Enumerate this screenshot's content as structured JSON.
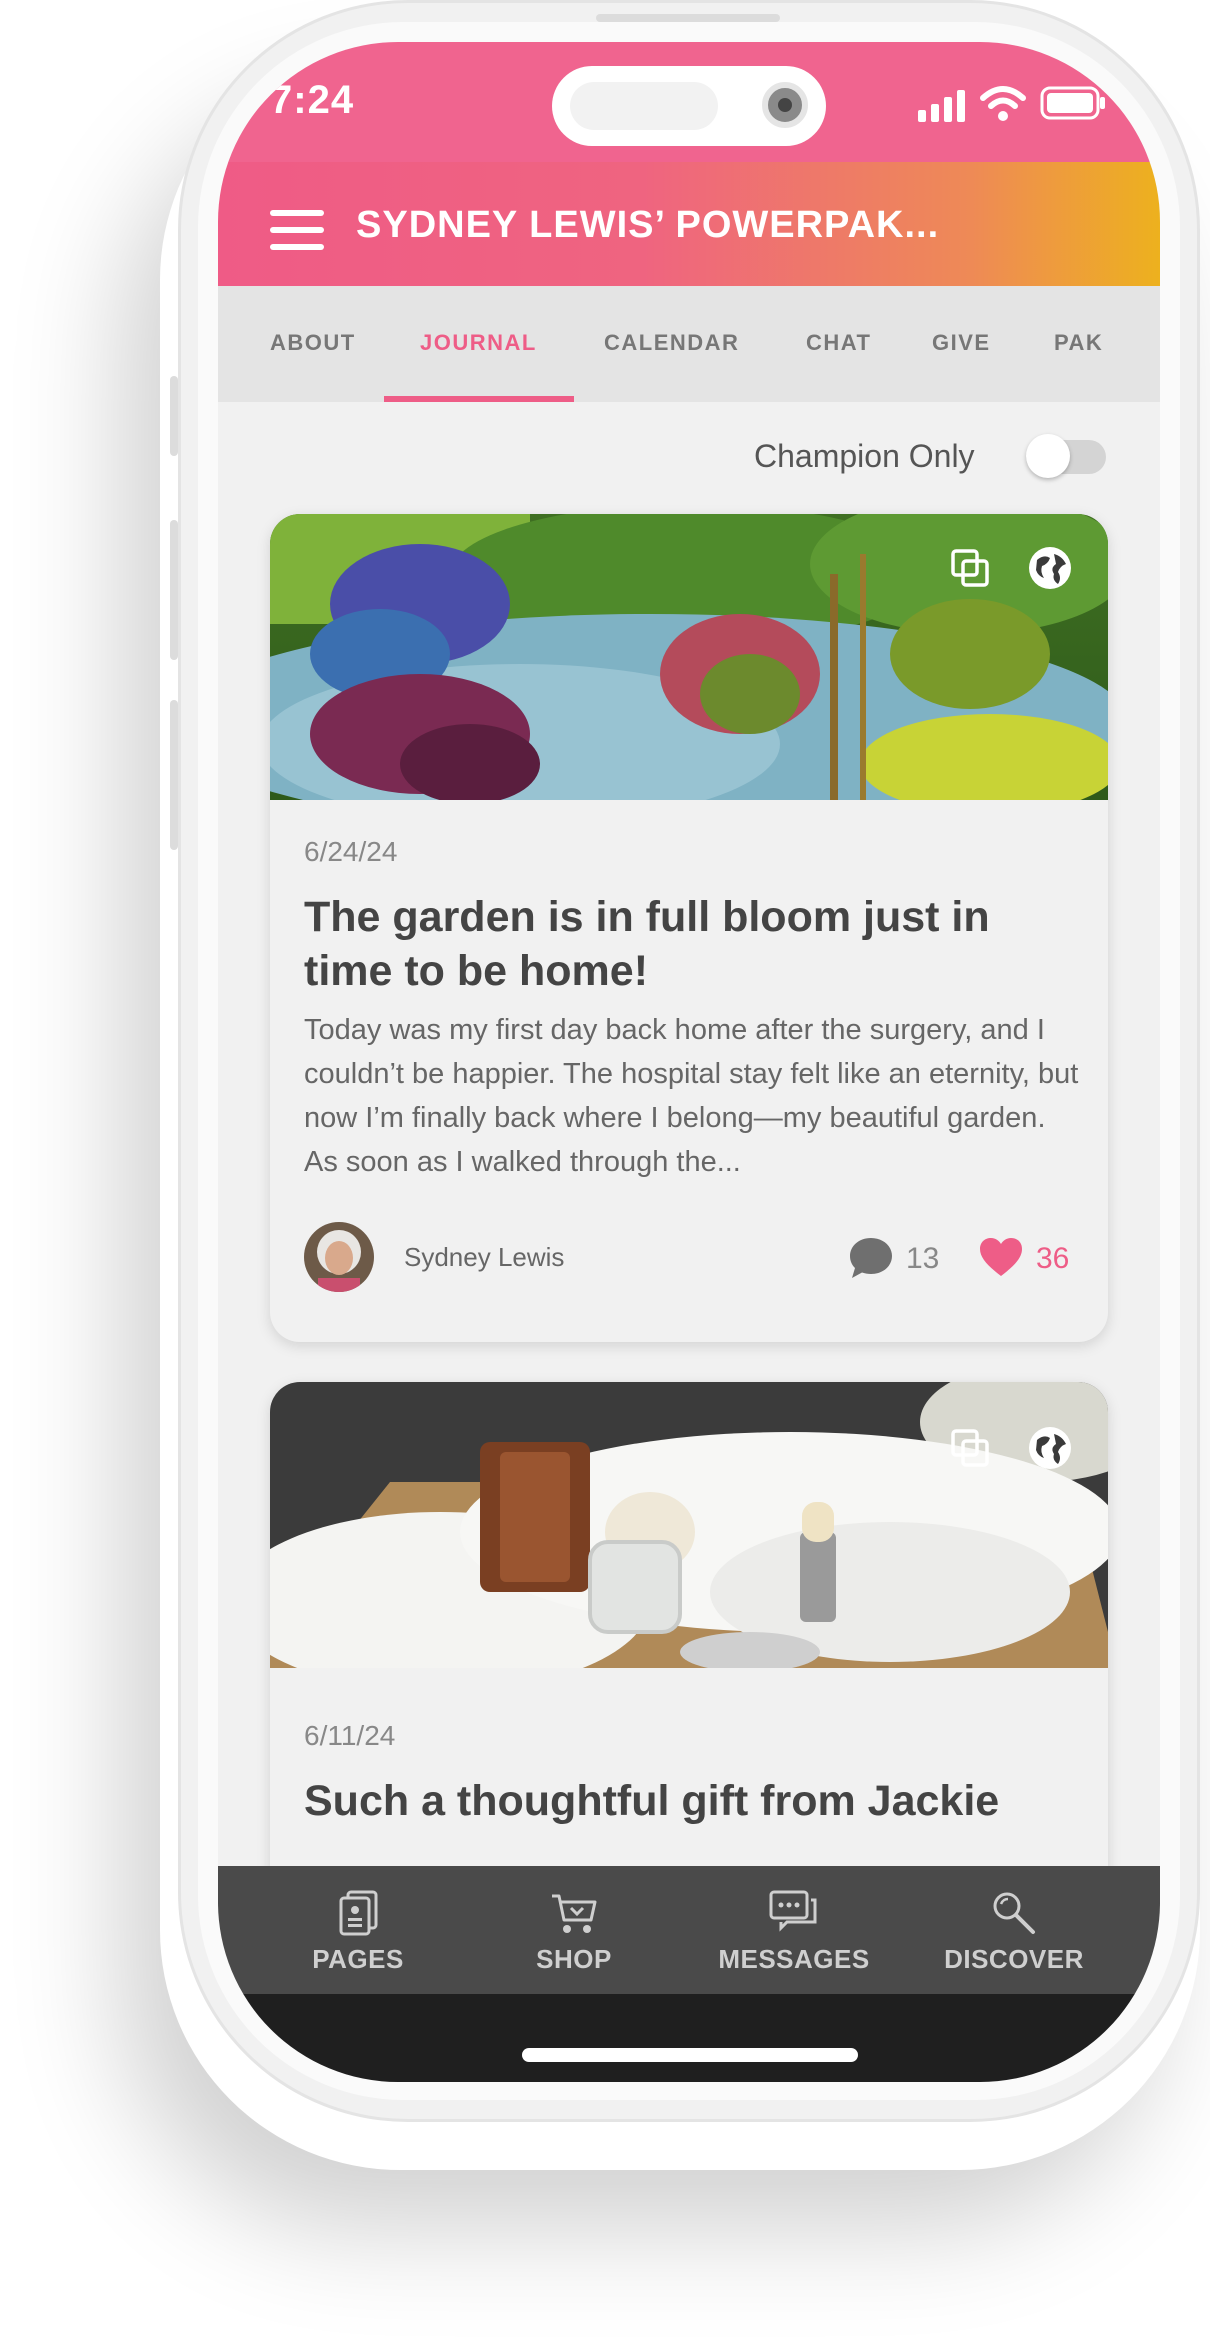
{
  "status_bar": {
    "time": "7:24"
  },
  "app_bar": {
    "title": "SYDNEY LEWIS’ POWERPAK..."
  },
  "tabs": [
    {
      "label": "ABOUT"
    },
    {
      "label": "JOURNAL",
      "active": true
    },
    {
      "label": "CALENDAR"
    },
    {
      "label": "CHAT"
    },
    {
      "label": "GIVE"
    },
    {
      "label": "PAK"
    }
  ],
  "filter": {
    "label": "Champion Only",
    "enabled": false
  },
  "posts": [
    {
      "date": "6/24/24",
      "title": "The garden is in full bloom just in time to be home!",
      "excerpt": "Today was my first day back home after the surgery, and I couldn’t be happier. The hospital stay felt like an eternity, but now I’m finally back where I belong—my beautiful garden. As soon as I walked through the...",
      "author": "Sydney Lewis",
      "comments": "13",
      "likes": "36",
      "image": "garden-photo",
      "icons": [
        "copy-icon",
        "globe-icon"
      ]
    },
    {
      "date": "6/11/24",
      "title": "Such a thoughtful gift from Jackie",
      "image": "spa-basket-photo",
      "icons": [
        "copy-icon",
        "globe-icon"
      ]
    }
  ],
  "bottom_nav": [
    {
      "label": "PAGES",
      "icon": "pages-icon"
    },
    {
      "label": "SHOP",
      "icon": "cart-icon"
    },
    {
      "label": "MESSAGES",
      "icon": "messages-icon"
    },
    {
      "label": "DISCOVER",
      "icon": "discover-icon"
    }
  ],
  "colors": {
    "accent": "#ee5d87",
    "gradient_end": "#edb11e",
    "nav_bg": "#4a4a4a",
    "screen_bg": "#f1f1f1"
  }
}
